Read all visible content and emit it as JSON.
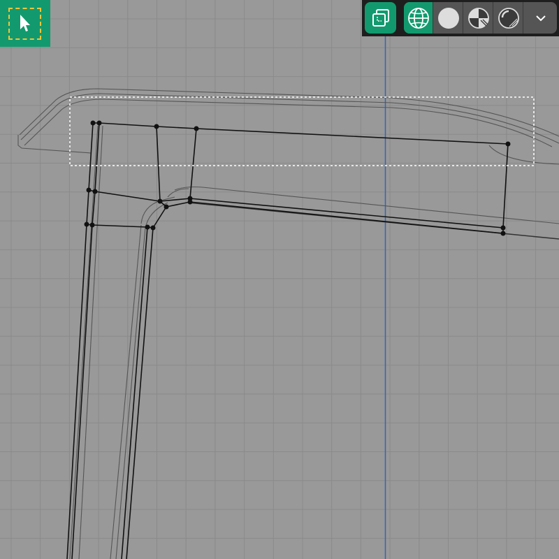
{
  "viewport": {
    "background": "#999999",
    "grid_color": "#8A8A8A",
    "axis_color": "#2E67B8",
    "edge_color": "#111111",
    "ghost_edge_color": "#555555",
    "selection_box_color": "#FFFFFF",
    "mode": "edit-mode-box-select"
  },
  "tools": {
    "active_tool": "select-box",
    "icon": "cursor-arrow-icon",
    "accent": "#129A6E",
    "marquee_color": "#F2C43A"
  },
  "header_toolbar": {
    "overlay_button": {
      "icon": "overlays-icon",
      "active": true
    },
    "shading_modes": [
      {
        "name": "wireframe",
        "icon": "wireframe-sphere-icon",
        "active": true
      },
      {
        "name": "solid",
        "icon": "solid-sphere-icon",
        "active": false
      },
      {
        "name": "material-preview",
        "icon": "material-sphere-icon",
        "active": false
      },
      {
        "name": "rendered",
        "icon": "rendered-sphere-icon",
        "active": false
      }
    ],
    "dropdown_icon": "chevron-down-icon"
  }
}
